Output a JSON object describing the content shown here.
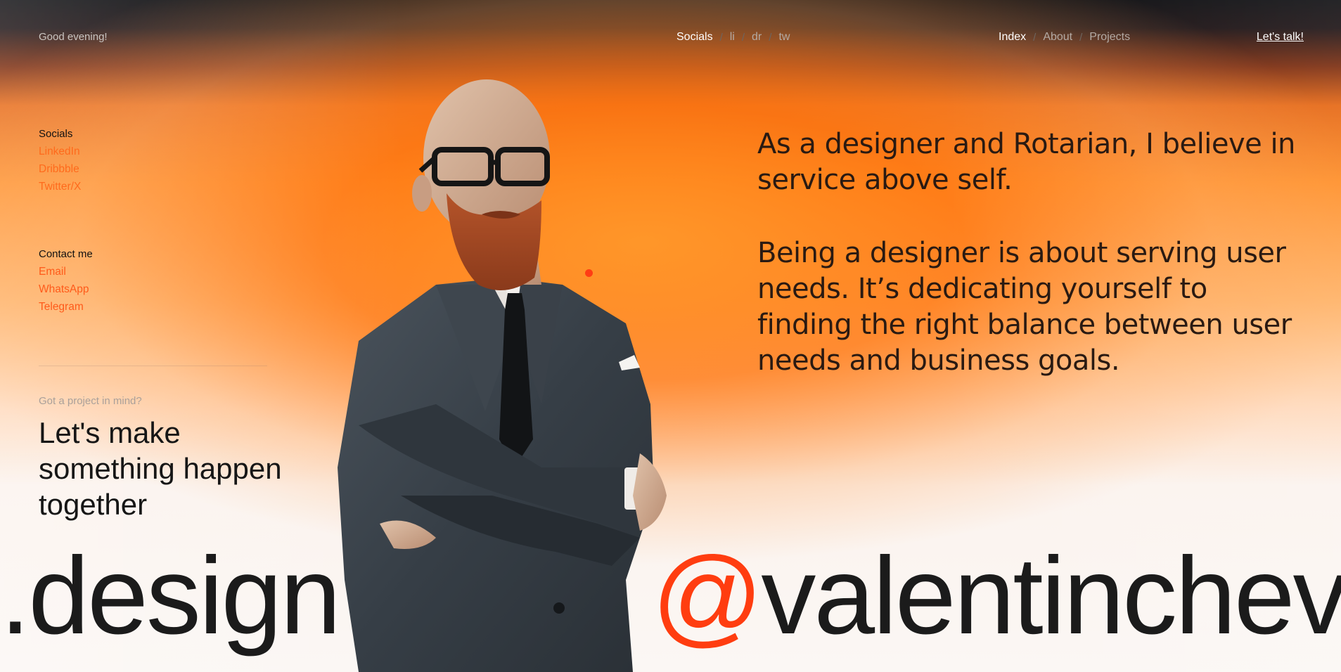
{
  "header": {
    "greeting": "Good evening!",
    "socials_nav": {
      "label": "Socials",
      "links": [
        "li",
        "dr",
        "tw"
      ]
    },
    "main_nav": {
      "active": "Index",
      "links": [
        "About",
        "Projects"
      ]
    },
    "cta": "Let's talk!",
    "separator": "/"
  },
  "sidebar": {
    "socials": {
      "title": "Socials",
      "links": [
        "LinkedIn",
        "Dribbble",
        "Twitter/X"
      ]
    },
    "contact": {
      "title": "Contact me",
      "links": [
        "Email",
        "WhatsApp",
        "Telegram"
      ]
    },
    "prompt": "Got a project in mind?",
    "headline": "Let's make something happen together"
  },
  "statement": {
    "p1": "As a designer and Rotarian, I believe in service above self.",
    "p2": "Being a designer is about serving user needs. It’s dedicating yourself to finding the right balance between user needs and business goals."
  },
  "branding": {
    "left": ".design",
    "at": "@",
    "right": "valentinchev"
  },
  "colors": {
    "accent": "#ff5a1a",
    "text": "#161616",
    "dark_top": "#0d0d10",
    "orange": "#ff8a1e"
  }
}
